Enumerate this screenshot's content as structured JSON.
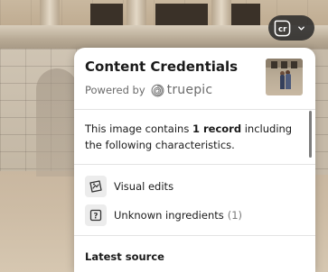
{
  "badge": {
    "label": "cr",
    "icon": "content-credentials-icon",
    "chevron_icon": "chevron-down-icon"
  },
  "panel": {
    "title": "Content Credentials",
    "powered_by": "Powered by",
    "provider": "truepic",
    "provider_icon": "truepic-logo-icon",
    "thumbnail": "image-thumbnail"
  },
  "summary": {
    "prefix": "This image contains ",
    "emphasis": "1 record",
    "suffix": " including the following characteristics."
  },
  "items": [
    {
      "label": "Visual edits",
      "count": "",
      "icon": "visual-edits-icon"
    },
    {
      "label": "Unknown ingredients",
      "count": "(1)",
      "icon": "unknown-ingredients-icon"
    }
  ],
  "latest_source": {
    "title": "Latest source"
  },
  "colors": {
    "badge_bg": "#282828",
    "text_primary": "#1a1a1a",
    "text_secondary": "#6b6b6b",
    "icon_bg": "#ececec"
  }
}
